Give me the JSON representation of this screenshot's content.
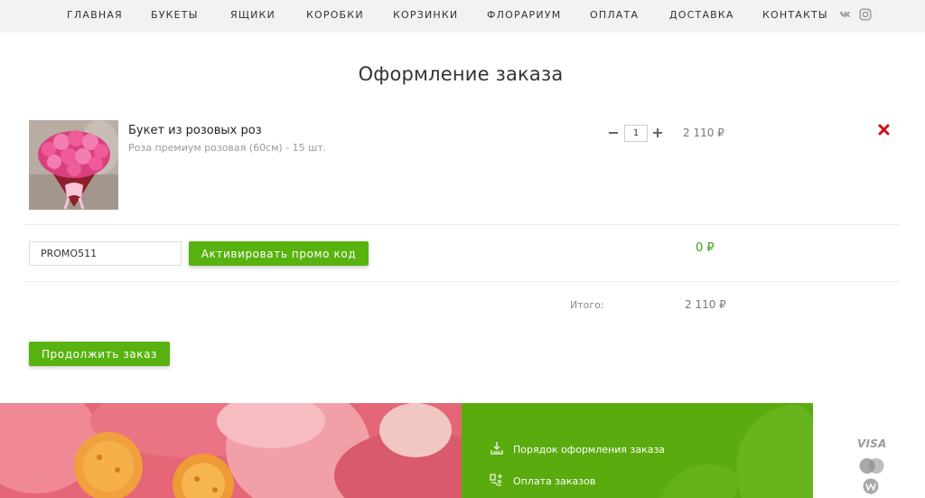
{
  "nav": {
    "items": [
      {
        "label": "ГЛАВНАЯ"
      },
      {
        "label": "БУКЕТЫ"
      },
      {
        "label": "ЯЩИКИ"
      },
      {
        "label": "КОРОБКИ"
      },
      {
        "label": "КОРЗИНКИ"
      },
      {
        "label": "ФЛОРАРИУМ"
      },
      {
        "label": "ОПЛАТА"
      },
      {
        "label": "ДОСТАВКА"
      },
      {
        "label": "КОНТАКТЫ"
      }
    ],
    "social": {
      "vk": "vk-icon",
      "instagram": "instagram-icon"
    }
  },
  "page": {
    "title": "Оформление заказа"
  },
  "cart": {
    "item": {
      "name": "Букет из розовых роз",
      "description": "Роза премиум розовая (60см) - 15 шт.",
      "quantity": "1",
      "price": "2 110 ₽"
    }
  },
  "promo": {
    "code": "PROMO511",
    "button_label": "Активировать промо код",
    "discount": "0 ₽"
  },
  "total": {
    "label": "Итого:",
    "value": "2 110 ₽"
  },
  "checkout": {
    "continue_label": "Продолжить заказ"
  },
  "footer": {
    "links": [
      {
        "label": "Порядок оформления заказа",
        "icon": "download-tray-icon"
      },
      {
        "label": "Оплата заказов",
        "icon": "payment-hand-icon"
      }
    ],
    "payment": {
      "visa": "VISA",
      "mastercard_icon": "mastercard-icon",
      "webmoney_icon": "webmoney-icon"
    }
  },
  "colors": {
    "accent_green": "#58b20f",
    "footer_green": "#5aab0e",
    "remove_red": "#cc1111",
    "nav_bg": "#f2f2f2"
  }
}
